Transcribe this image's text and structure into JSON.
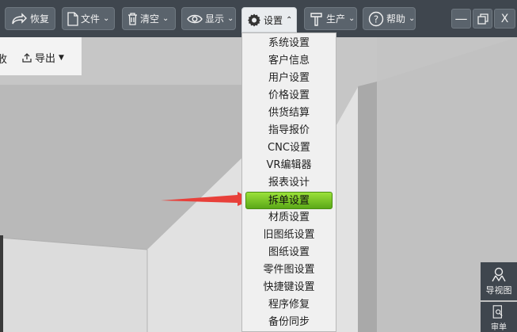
{
  "toolbar": {
    "restore": "恢复",
    "file": "文件",
    "clear": "清空",
    "display": "显示",
    "settings": "设置",
    "production": "生产",
    "help": "帮助"
  },
  "window_controls": {
    "close": "X"
  },
  "subbar": {
    "cut_text": "收",
    "export": "导出"
  },
  "settings_menu": {
    "items": [
      "系统设置",
      "客户信息",
      "用户设置",
      "价格设置",
      "供货结算",
      "指导报价",
      "CNC设置",
      "VR编辑器",
      "报表设计",
      "拆单设置",
      "材质设置",
      "旧图纸设置",
      "图纸设置",
      "零件图设置",
      "快捷键设置",
      "程序修复",
      "备份同步"
    ],
    "highlighted_index": 9
  },
  "side_panel": {
    "guide_view": "导视图",
    "order": "审单"
  },
  "colors": {
    "toolbar_bg": "#3f464e",
    "highlight_green": "#7cc62a",
    "arrow_red": "#e8403a"
  }
}
